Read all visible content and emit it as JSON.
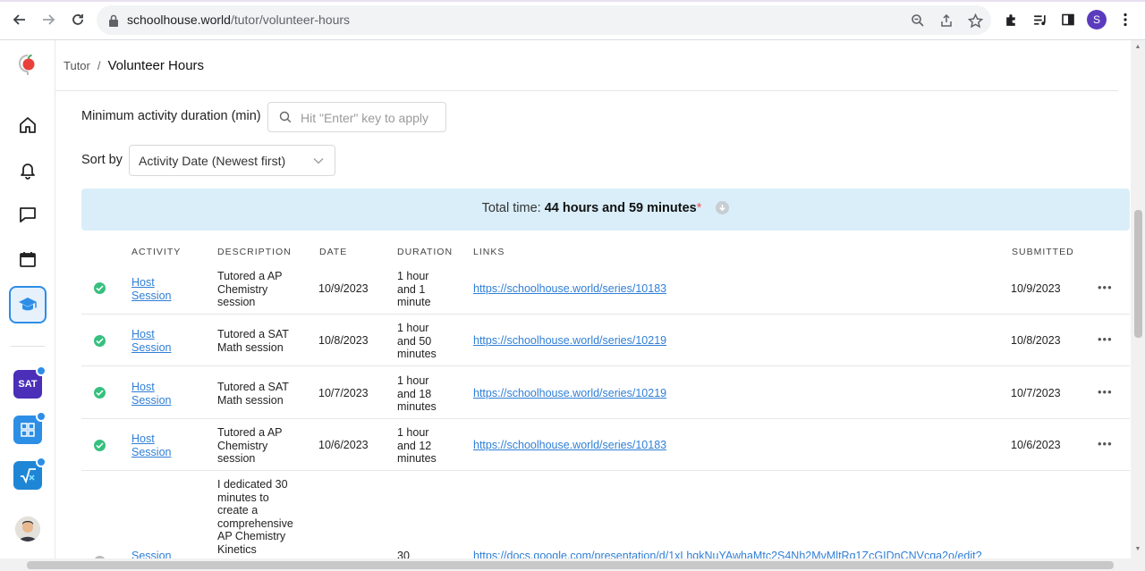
{
  "browser": {
    "url_host": "schoolhouse.world",
    "url_path": "/tutor/volunteer-hours",
    "profile_initial": "S"
  },
  "rail": {
    "items": [
      "home",
      "notifications",
      "messages",
      "calendar",
      "tutor"
    ],
    "apps": [
      {
        "label": "SAT",
        "color": "#4b2fb8"
      },
      {
        "label": "",
        "color": "#2d8ee6"
      },
      {
        "label": "",
        "color": "#1f86d6"
      }
    ]
  },
  "breadcrumb": {
    "parent": "Tutor",
    "separator": "/",
    "current": "Volunteer Hours"
  },
  "filters": {
    "min_duration_label": "Minimum activity duration (min)",
    "min_duration_placeholder": "Hit \"Enter\" key to apply",
    "sort_label": "Sort by",
    "sort_value": "Activity Date (Newest first)"
  },
  "total": {
    "prefix": "Total time:",
    "value": "44 hours and 59 minutes",
    "asterisk": "*"
  },
  "table": {
    "headers": {
      "activity": "ACTIVITY",
      "description": "DESCRIPTION",
      "date": "DATE",
      "duration": "DURATION",
      "links": "LINKS",
      "submitted": "SUBMITTED"
    },
    "rows": [
      {
        "activity_l1": "Host",
        "activity_l2": "Session",
        "desc": [
          "Tutored a AP",
          "Chemistry",
          "session"
        ],
        "date": "10/9/2023",
        "duration": [
          "1 hour",
          "and 1",
          "minute"
        ],
        "link": "https://schoolhouse.world/series/10183",
        "submitted": "10/9/2023"
      },
      {
        "activity_l1": "Host",
        "activity_l2": "Session",
        "desc": [
          "Tutored a SAT",
          "Math session"
        ],
        "date": "10/8/2023",
        "duration": [
          "1 hour",
          "and 50",
          "minutes"
        ],
        "link": "https://schoolhouse.world/series/10219",
        "submitted": "10/8/2023"
      },
      {
        "activity_l1": "Host",
        "activity_l2": "Session",
        "desc": [
          "Tutored a SAT",
          "Math session"
        ],
        "date": "10/7/2023",
        "duration": [
          "1 hour",
          "and 18",
          "minutes"
        ],
        "link": "https://schoolhouse.world/series/10219",
        "submitted": "10/7/2023"
      },
      {
        "activity_l1": "Host",
        "activity_l2": "Session",
        "desc": [
          "Tutored a AP",
          "Chemistry",
          "session"
        ],
        "date": "10/6/2023",
        "duration": [
          "1 hour",
          "and 12",
          "minutes"
        ],
        "link": "https://schoolhouse.world/series/10183",
        "submitted": "10/6/2023"
      },
      {
        "activity_l1": "Session",
        "activity_l2": "",
        "desc": [
          "I dedicated 30",
          "minutes to",
          "create a",
          "comprehensive",
          "AP Chemistry",
          "Kinetics"
        ],
        "date": "",
        "duration": [
          "30"
        ],
        "link": "https://docs.google.com/presentation/d/1xLhqkNuYAwhaMtc2S4Nh2MvMltRq1ZcGIDnCNVcqa2o/edit?",
        "submitted": ""
      }
    ]
  },
  "colors": {
    "accent": "#2d8ee6",
    "banner": "#d9eef9",
    "status_ok": "#36c07e",
    "link": "#2f7fd6"
  }
}
